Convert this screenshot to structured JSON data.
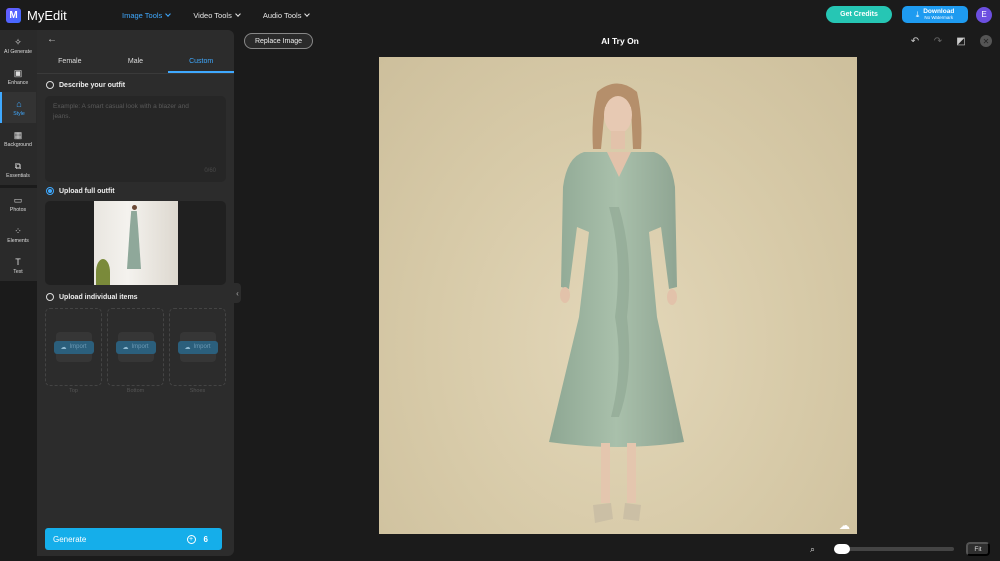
{
  "header": {
    "app_name": "MyEdit",
    "logo_letter": "M",
    "nav": [
      {
        "label": "Image Tools",
        "active": true
      },
      {
        "label": "Video Tools",
        "active": false
      },
      {
        "label": "Audio Tools",
        "active": false
      }
    ],
    "get_credits_label": "Get Credits",
    "download_label": "Download",
    "download_sub": "No Watermark",
    "avatar_initial": "E"
  },
  "rail": {
    "items": [
      {
        "label": "AI Generate",
        "icon": "magic-wand-icon",
        "glyph": "✧"
      },
      {
        "label": "Enhance",
        "icon": "enhance-icon",
        "glyph": "▣"
      },
      {
        "label": "Style",
        "icon": "style-icon",
        "glyph": "⌂"
      },
      {
        "label": "Background",
        "icon": "background-icon",
        "glyph": "▦"
      },
      {
        "label": "Essentials",
        "icon": "essentials-icon",
        "glyph": "⧉"
      },
      {
        "label": "Photos",
        "icon": "photos-icon",
        "glyph": "▭"
      },
      {
        "label": "Elements",
        "icon": "elements-icon",
        "glyph": "⁘"
      },
      {
        "label": "Text",
        "icon": "text-icon",
        "glyph": "T"
      }
    ]
  },
  "panel": {
    "back_glyph": "←",
    "tabs": [
      {
        "label": "Female",
        "active": false
      },
      {
        "label": "Male",
        "active": false
      },
      {
        "label": "Custom",
        "active": true
      }
    ],
    "describe_label": "Describe your outfit",
    "describe_placeholder": "Example: A smart casual look with a blazer and jeans.",
    "describe_counter": "0/60",
    "upload_full_label": "Upload full outfit",
    "upload_items_label": "Upload individual items",
    "import_label": "Import",
    "slots": [
      {
        "label": "Top"
      },
      {
        "label": "Bottom"
      },
      {
        "label": "Shoes"
      }
    ],
    "generate_label": "Generate",
    "generate_cost": "6",
    "collapse_glyph": "‹"
  },
  "canvas": {
    "replace_label": "Replace Image",
    "title": "AI Try On",
    "fit_label": "Fit",
    "zoom_level": 0.0
  },
  "colors": {
    "accent": "#3fa9ff",
    "credits": "#26c6b4",
    "download": "#1e9bf0",
    "generate": "#15aeea",
    "avatar": "#6c4fe0",
    "photo_bg": "#d9cca9",
    "dress": "#9fb8a4"
  }
}
